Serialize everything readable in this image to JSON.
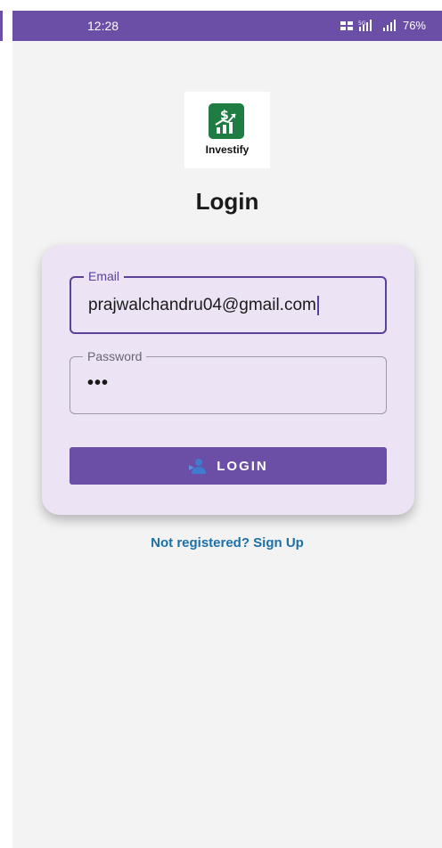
{
  "status_bar": {
    "time": "12:28",
    "battery": "76%",
    "icons": [
      "network-speed-icon",
      "signal-5g-icon",
      "signal-icon"
    ]
  },
  "logo": {
    "icon": "chart-dollar-icon",
    "brand_name": "Investify"
  },
  "page": {
    "title": "Login"
  },
  "form": {
    "email_label": "Email",
    "email_value": "prajwalchandru04@gmail.com",
    "password_label": "Password",
    "password_value": "•••",
    "login_button_label": "LOGIN",
    "login_button_icon": "login-icon"
  },
  "footer": {
    "signup_link": "Not registered? Sign Up"
  },
  "colors": {
    "primary": "#6b4fa6",
    "card": "#ece4f4",
    "logo_green": "#1f7d44",
    "link": "#1d6fa8",
    "background": "#f3f3f3"
  }
}
